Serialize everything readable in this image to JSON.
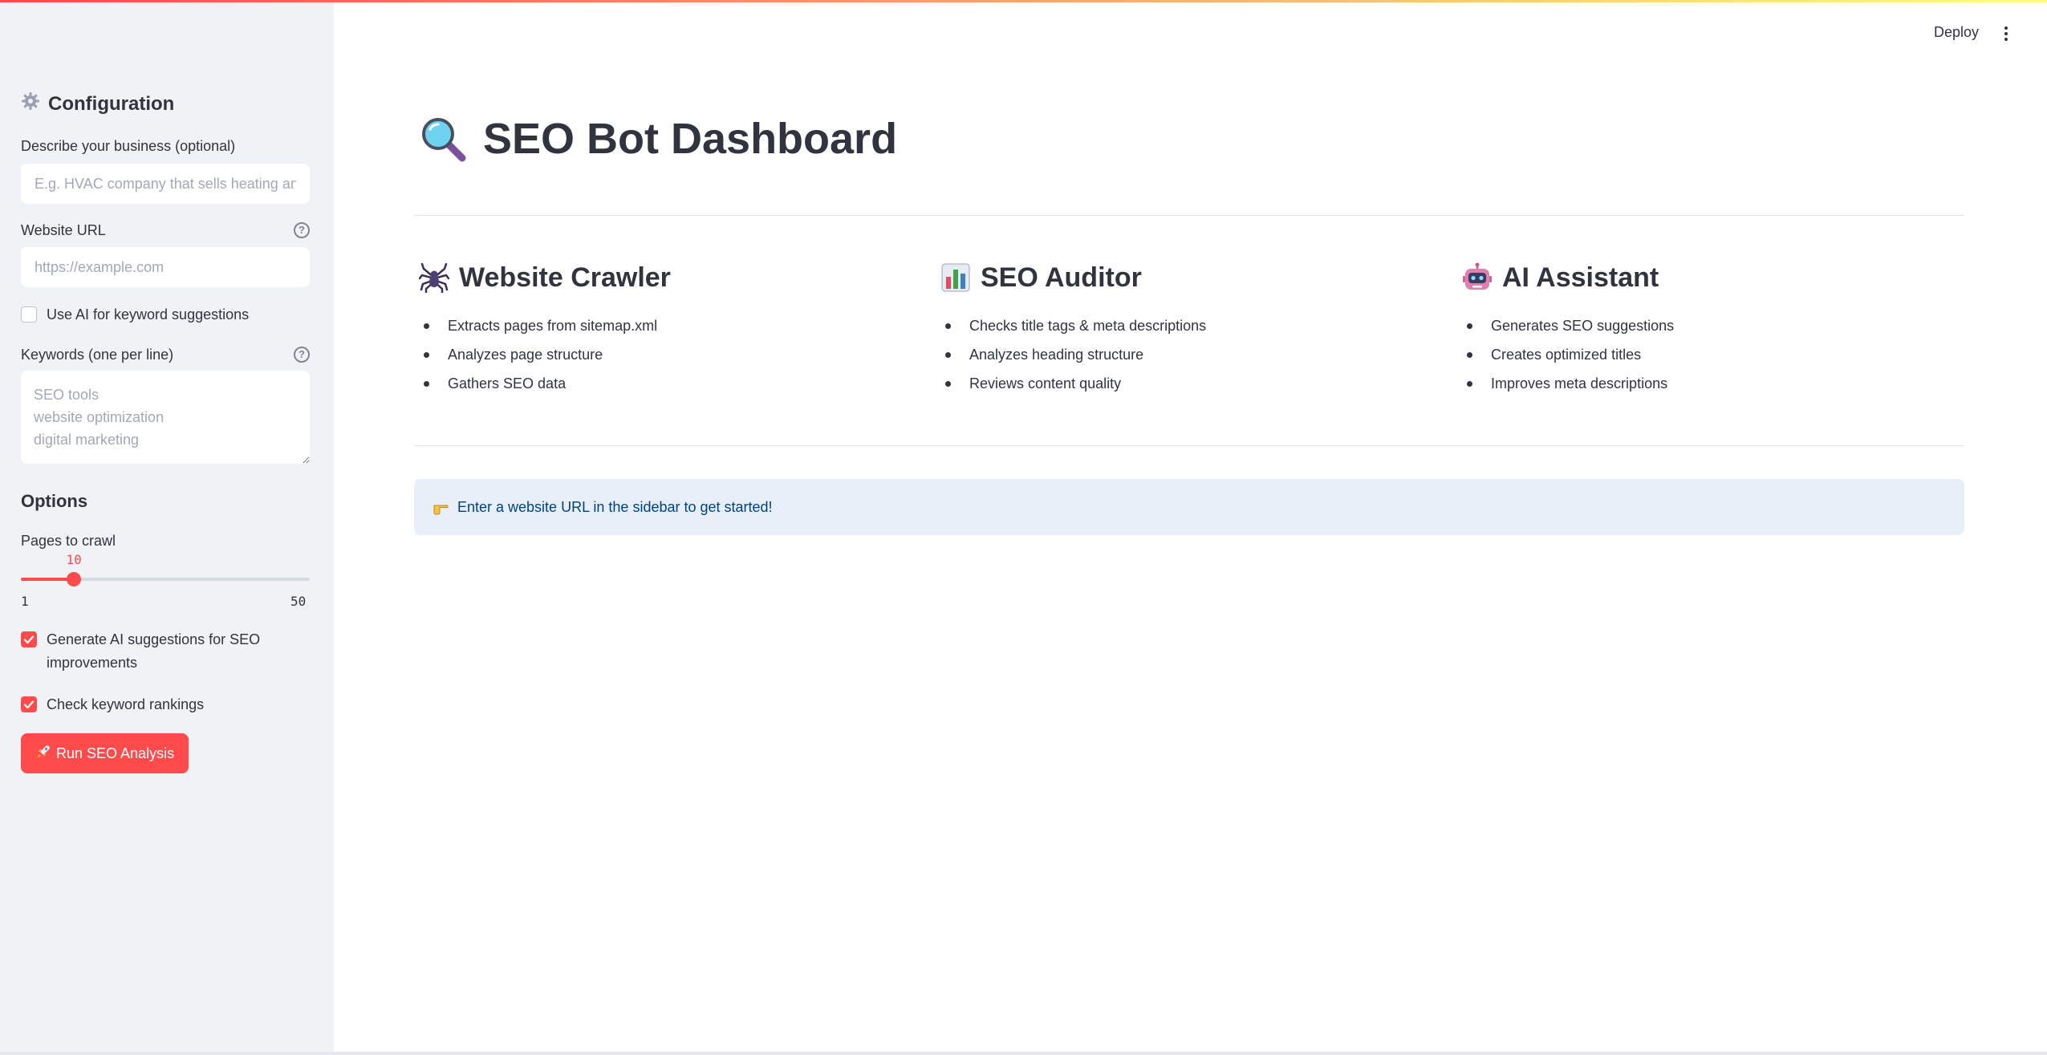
{
  "header": {
    "deploy_label": "Deploy",
    "menu_icon": "kebab-menu-icon"
  },
  "sidebar": {
    "title": "Configuration",
    "title_icon": "gear-icon",
    "business": {
      "label": "Describe your business (optional)",
      "value": "",
      "placeholder": "E.g. HVAC company that sells heating and cooling"
    },
    "website_url": {
      "label": "Website URL",
      "value": "",
      "placeholder": "https://example.com"
    },
    "use_ai_keywords": {
      "label": "Use AI for keyword suggestions",
      "checked": false
    },
    "keywords": {
      "label": "Keywords (one per line)",
      "value": "",
      "placeholder": "SEO tools\nwebsite optimization\ndigital marketing"
    },
    "options_heading": "Options",
    "pages_to_crawl": {
      "label": "Pages to crawl",
      "value": 10,
      "value_text": "10",
      "min": 1,
      "max": 50,
      "min_text": "1",
      "max_text": "50"
    },
    "generate_ai": {
      "label": "Generate AI suggestions for SEO improvements",
      "checked": true
    },
    "check_rankings": {
      "label": "Check keyword rankings",
      "checked": true
    },
    "run_button": {
      "icon": "rocket-icon",
      "label": "Run SEO Analysis"
    }
  },
  "main": {
    "title": "SEO Bot Dashboard",
    "title_icon": "magnifying-glass-icon",
    "features": [
      {
        "title": "Website Crawler",
        "icon": "spider-icon",
        "items": [
          "Extracts pages from sitemap.xml",
          "Analyzes page structure",
          "Gathers SEO data"
        ]
      },
      {
        "title": "SEO Auditor",
        "icon": "bar-chart-icon",
        "items": [
          "Checks title tags & meta descriptions",
          "Analyzes heading structure",
          "Reviews content quality"
        ]
      },
      {
        "title": "AI Assistant",
        "icon": "robot-icon",
        "items": [
          "Generates SEO suggestions",
          "Creates optimized titles",
          "Improves meta descriptions"
        ]
      }
    ],
    "info": {
      "icon": "pointing-hand-icon",
      "text": "Enter a website URL in the sidebar to get started!"
    }
  },
  "colors": {
    "accent": "#ff4b4b",
    "sidebar_bg": "#f0f2f6",
    "info_bg": "#e8eff9",
    "info_text": "#004280",
    "text": "#31333f"
  }
}
